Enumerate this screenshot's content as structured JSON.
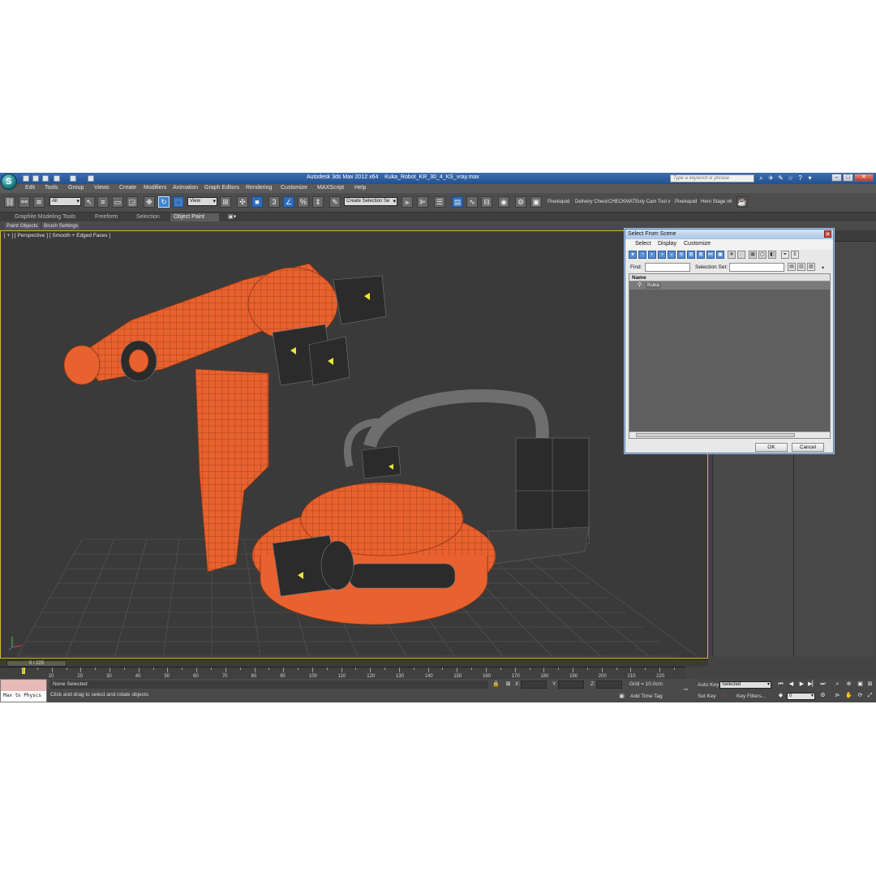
{
  "window": {
    "app_title": "Autodesk 3ds Max  2012 x64",
    "file_name": "Kuka_Robot_KR_30_4_KS_vray.max",
    "search_placeholder": "Type a keyword or phrase",
    "logo_letter": "S"
  },
  "menu": [
    "Edit",
    "Tools",
    "Group",
    "Views",
    "Create",
    "Modifiers",
    "Animation",
    "Graph Editors",
    "Rendering",
    "Customize",
    "MAXScript",
    "Help"
  ],
  "toolbar": {
    "filter_combo": "All",
    "coord_combo": "View",
    "selection_set_combo": "Create Selection Se",
    "plugins": [
      "Pixelsquid",
      "Delivery Check",
      "CHECKMATE",
      "uty Cam Tool v",
      "Pixelsquid",
      "Hero Stage v6"
    ]
  },
  "ribbon": {
    "tabs": [
      "Graphite Modeling Tools",
      "Freeform",
      "Selection",
      "Object Paint"
    ],
    "active_tab": "Object Paint",
    "subtabs": [
      "Paint Objects",
      "Brush Settings"
    ]
  },
  "viewport": {
    "label": "[ + ] [ Perspective ] [ Smooth + Edged Faces ]",
    "colors": {
      "robot": "#e8612e",
      "motor": "#2b2b2b",
      "cable": "#6e6e6e",
      "grid": "#5a5a5a"
    }
  },
  "dialog": {
    "title": "Select From Scene",
    "menu": [
      "Select",
      "Display",
      "Customize"
    ],
    "find_label": "Find:",
    "find_value": "",
    "selection_set_label": "Selection Set:",
    "column_header": "Name",
    "items": [
      {
        "name": "Kuka",
        "icon": "object-icon"
      }
    ],
    "ok_label": "OK",
    "cancel_label": "Cancel"
  },
  "timeline": {
    "current_frame": 0,
    "total_frames": 225,
    "slider_text": "0 / 225",
    "ruler_labels": [
      "10",
      "20",
      "30",
      "40",
      "50",
      "60",
      "70",
      "80",
      "90",
      "100",
      "110",
      "120",
      "130",
      "140",
      "150",
      "160",
      "170",
      "180",
      "190",
      "200",
      "210",
      "220"
    ]
  },
  "status": {
    "maxscript_text": "Max to Physcs",
    "selection": "None Selected",
    "prompt": "Click and drag to select and rotate objects",
    "x_label": "X:",
    "y_label": "Y:",
    "z_label": "Z:",
    "grid": "Grid = 10,0cm",
    "add_time_tag": "Add Time Tag"
  },
  "animation": {
    "auto_key": "Auto Key",
    "set_key": "Set Key",
    "selected_combo": "Selected",
    "key_filters": "Key Filters...",
    "frame_value": "0"
  }
}
